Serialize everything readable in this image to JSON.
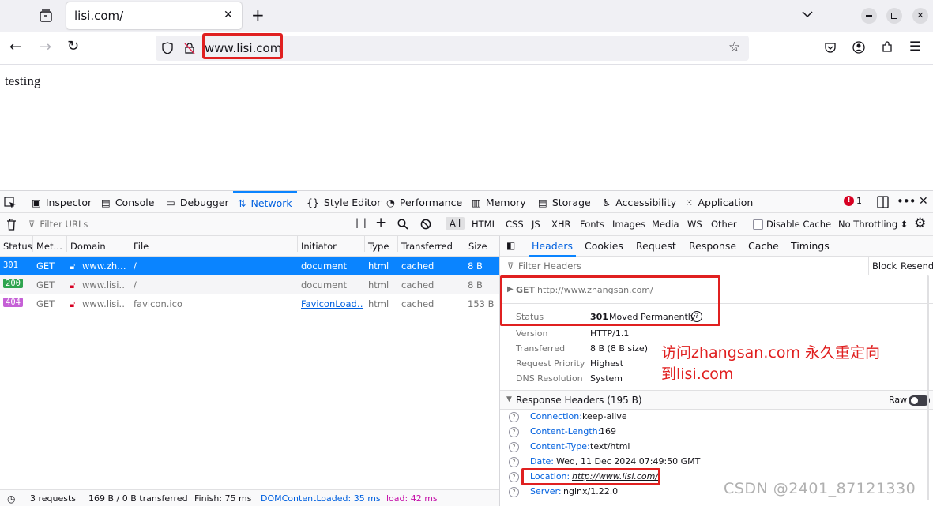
{
  "browser": {
    "tab_title": "lisi.com/",
    "url": "www.lisi.com"
  },
  "page": {
    "body_text": "testing"
  },
  "devtools": {
    "tabs": [
      {
        "label": "Inspector"
      },
      {
        "label": "Console"
      },
      {
        "label": "Debugger"
      },
      {
        "label": "Network"
      },
      {
        "label": "Style Editor"
      },
      {
        "label": "Performance"
      },
      {
        "label": "Memory"
      },
      {
        "label": "Storage"
      },
      {
        "label": "Accessibility"
      },
      {
        "label": "Application"
      }
    ],
    "active_tab": "Network",
    "error_count": "1",
    "network_toolbar": {
      "filter_placeholder": "Filter URLs",
      "types": [
        "All",
        "HTML",
        "CSS",
        "JS",
        "XHR",
        "Fonts",
        "Images",
        "Media",
        "WS",
        "Other"
      ],
      "disable_cache_label": "Disable Cache",
      "throttling": "No Throttling ⬍"
    },
    "columns": [
      "Status",
      "Met…",
      "Domain",
      "File",
      "Initiator",
      "Type",
      "Transferred",
      "Size"
    ],
    "requests": [
      {
        "status": "301",
        "method": "GET",
        "domain": "www.zh…",
        "file": "/",
        "initiator": "document",
        "type": "html",
        "transferred": "cached",
        "size": "8 B"
      },
      {
        "status": "200",
        "method": "GET",
        "domain": "www.lisi…",
        "file": "/",
        "initiator": "document",
        "type": "html",
        "transferred": "cached",
        "size": "8 B"
      },
      {
        "status": "404",
        "method": "GET",
        "domain": "www.lisi…",
        "file": "favicon.ico",
        "initiator": "FaviconLoad…",
        "type": "html",
        "transferred": "cached",
        "size": "153 B"
      }
    ],
    "status_bar": {
      "requests": "3 requests",
      "transferred": "169 B / 0 B transferred",
      "finish": "Finish: 75 ms",
      "dcl": "DOMContentLoaded: 35 ms",
      "load": "load: 42 ms"
    },
    "details": {
      "tabs": [
        "Headers",
        "Cookies",
        "Request",
        "Response",
        "Cache",
        "Timings"
      ],
      "filter_placeholder": "Filter Headers",
      "block_label": "Block",
      "resend_label": "Resend",
      "request_method": "GET",
      "request_url": "http://www.zhangsan.com/",
      "summary": [
        {
          "key": "Status",
          "value_code": "301",
          "value": "Moved Permanently"
        },
        {
          "key": "Version",
          "value": "HTTP/1.1"
        },
        {
          "key": "Transferred",
          "value": "8 B (8 B size)"
        },
        {
          "key": "Request Priority",
          "value": "Highest"
        },
        {
          "key": "DNS Resolution",
          "value": "System"
        }
      ],
      "response_headers_title": "Response Headers (195 B)",
      "raw_label": "Raw",
      "response_headers": [
        {
          "key": "Connection:",
          "value": "keep-alive"
        },
        {
          "key": "Content-Length:",
          "value": "169"
        },
        {
          "key": "Content-Type:",
          "value": "text/html"
        },
        {
          "key": "Date:",
          "value": "Wed, 11 Dec 2024 07:49:50 GMT"
        },
        {
          "key": "Location:",
          "value": "http://www.lisi.com/"
        },
        {
          "key": "Server:",
          "value": "nginx/1.22.0"
        }
      ]
    }
  },
  "annotation": {
    "line1": "访问zhangsan.com  永久重定向",
    "line2": "到lisi.com"
  },
  "watermark": "CSDN @2401_87121330",
  "colors": {
    "accent": "#0a84ff",
    "annotation_red": "#e02020",
    "status_200": "#2fa44f",
    "status_404": "#c560d6"
  }
}
